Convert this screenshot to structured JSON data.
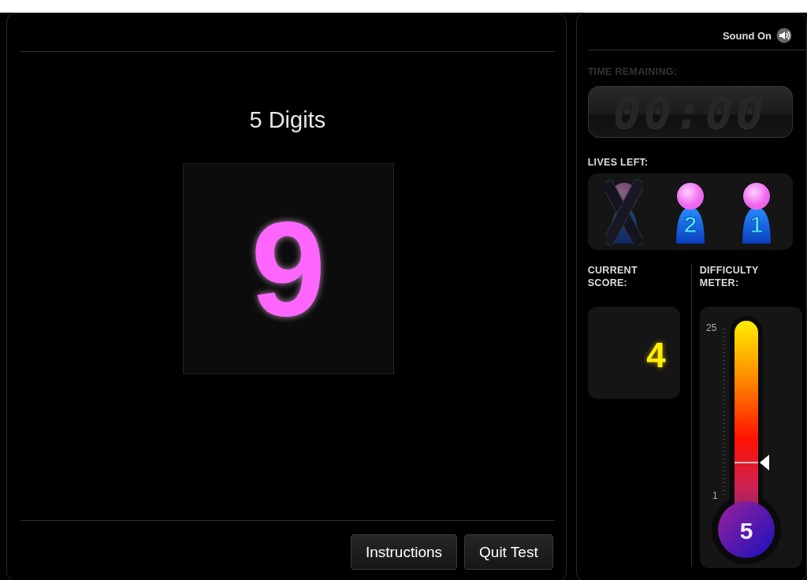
{
  "game": {
    "title": "5 Digits",
    "digit": "9"
  },
  "buttons": [
    "Instructions",
    "Quit Test"
  ],
  "sound": {
    "label": "Sound On",
    "on": true
  },
  "timer": {
    "label": "TIME REMAINING:",
    "display": "00:00",
    "active": false
  },
  "lives": {
    "label": "LIVES LEFT:",
    "items": [
      {
        "lost": true
      },
      {
        "lost": false,
        "number": "2"
      },
      {
        "lost": false,
        "number": "1"
      }
    ]
  },
  "score": {
    "label": "CURRENT SCORE:",
    "value": "4"
  },
  "difficulty": {
    "label": "DIFFICULTY METER:",
    "max": "25",
    "min": "1",
    "value": "5",
    "level": 0.2
  }
}
